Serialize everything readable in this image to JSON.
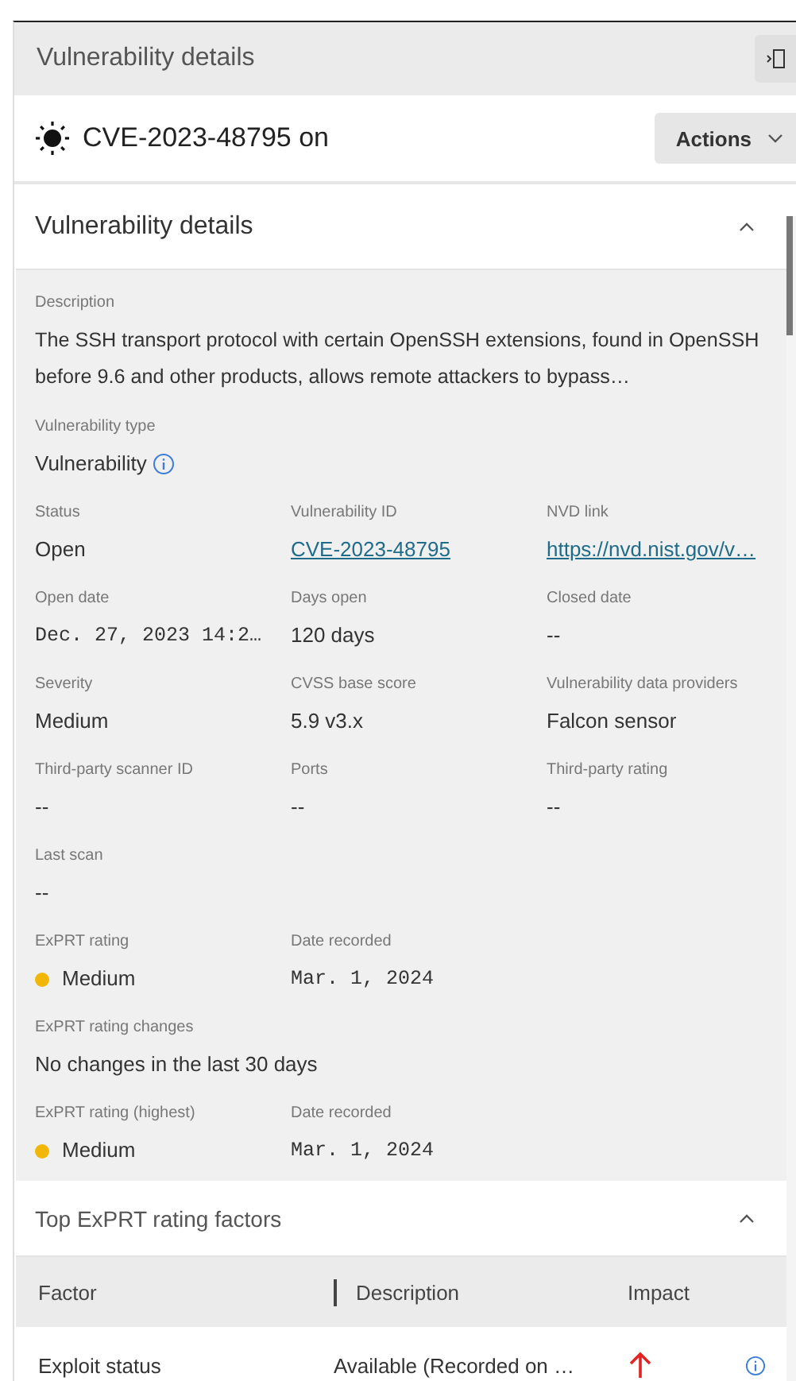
{
  "panel": {
    "title": "Vulnerability details"
  },
  "header": {
    "title": "CVE-2023-48795 on",
    "actions_label": "Actions"
  },
  "details": {
    "title": "Vulnerability details",
    "expanded": true,
    "rows": [
      [
        {
          "label": "Description",
          "value": "The SSH transport protocol with certain OpenSSH extensions, found in OpenSSH before 9.6 and other products, allows remote attackers to bypass…",
          "kind": "text"
        }
      ],
      [
        {
          "label": "Vulnerability type",
          "value": "Vulnerability",
          "kind": "info"
        }
      ],
      [
        {
          "label": "Status",
          "value": "Open",
          "kind": "text"
        },
        {
          "label": "Vulnerability ID",
          "value": "CVE-2023-48795",
          "kind": "link"
        },
        {
          "label": "NVD link",
          "value": "https://nvd.nist.gov/v…",
          "kind": "link"
        }
      ],
      [
        {
          "label": "Open date",
          "value": "Dec. 27, 2023 14:2…",
          "kind": "mono"
        },
        {
          "label": "Days open",
          "value": "120 days",
          "kind": "text"
        },
        {
          "label": "Closed date",
          "value": "--",
          "kind": "text"
        }
      ],
      [
        {
          "label": "Severity",
          "value": "Medium",
          "kind": "text"
        },
        {
          "label": "CVSS base score",
          "value": "5.9 v3.x",
          "kind": "text"
        },
        {
          "label": "Vulnerability data providers",
          "value": "Falcon sensor",
          "kind": "text"
        }
      ],
      [
        {
          "label": "Third-party scanner ID",
          "value": "--",
          "kind": "text"
        },
        {
          "label": "Ports",
          "value": "--",
          "kind": "text"
        },
        {
          "label": "Third-party rating",
          "value": "--",
          "kind": "text"
        }
      ],
      [
        {
          "label": "Last scan",
          "value": "--",
          "kind": "text"
        }
      ],
      [
        {
          "label": "ExPRT rating",
          "value": "Medium",
          "kind": "rating",
          "color": "#f2b705"
        },
        {
          "label": "Date recorded",
          "value": "Mar. 1, 2024",
          "kind": "mono"
        }
      ],
      [
        {
          "label": "ExPRT rating changes",
          "value": "No changes in the last 30 days",
          "kind": "text"
        }
      ],
      [
        {
          "label": "ExPRT rating (highest)",
          "value": "Medium",
          "kind": "rating",
          "color": "#f2b705"
        },
        {
          "label": "Date recorded",
          "value": "Mar. 1, 2024",
          "kind": "mono"
        }
      ]
    ]
  },
  "factors": {
    "title": "Top ExPRT rating factors",
    "expanded": true,
    "columns": [
      "Factor",
      "Description",
      "Impact"
    ],
    "rows": [
      {
        "factor": "Exploit status",
        "description": "Available (Recorded on …",
        "kind": "increase"
      }
    ]
  }
}
